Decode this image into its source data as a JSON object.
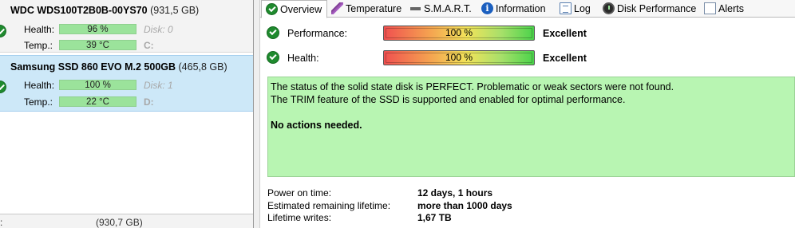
{
  "disks": [
    {
      "name": "WDC  WDS100T2B0B-00YS70",
      "size": "(931,5 GB)",
      "health_label": "Health:",
      "health_value": "96 %",
      "disk_label": "Disk: 0",
      "temp_label": "Temp.:",
      "temp_value": "39 °C",
      "drive": "C:"
    },
    {
      "name": "Samsung SSD 860 EVO M.2 500GB",
      "size": "(465,8 GB)",
      "health_label": "Health:",
      "health_value": "100 %",
      "disk_label": "Disk: 1",
      "temp_label": "Temp.:",
      "temp_value": "22 °C",
      "drive": "D:"
    },
    {
      "name": ":",
      "size": "(930,7 GB)"
    }
  ],
  "tabs": [
    {
      "label": "Overview",
      "icon": "ok-icon"
    },
    {
      "label": "Temperature",
      "icon": "thermometer-icon"
    },
    {
      "label": "S.M.A.R.T.",
      "icon": "smart-icon"
    },
    {
      "label": "Information",
      "icon": "info-icon"
    },
    {
      "label": "Log",
      "icon": "log-icon"
    },
    {
      "label": "Disk Performance",
      "icon": "performance-icon"
    },
    {
      "label": "Alerts",
      "icon": "alert-icon"
    }
  ],
  "overview": {
    "performance_label": "Performance:",
    "performance_value": "100 %",
    "performance_result": "Excellent",
    "health_label": "Health:",
    "health_value": "100 %",
    "health_result": "Excellent",
    "status_line1": "The status of the solid state disk is PERFECT. Problematic or weak sectors were not found.",
    "status_line2": "The TRIM feature of the SSD is supported and enabled for optimal performance.",
    "status_action": "No actions needed.",
    "power_on_label": "Power on time:",
    "power_on_value": "12 days, 1 hours",
    "lifetime_label": "Estimated remaining lifetime:",
    "lifetime_value": "more than 1000 days",
    "writes_label": "Lifetime writes:",
    "writes_value": "1,67 TB"
  },
  "colors": {
    "status_ok_bg": "#b8f5b2",
    "selected_disk_bg": "#cde8f8",
    "health_bar": "#9be39b",
    "ok_icon": "#1f8a2e"
  }
}
